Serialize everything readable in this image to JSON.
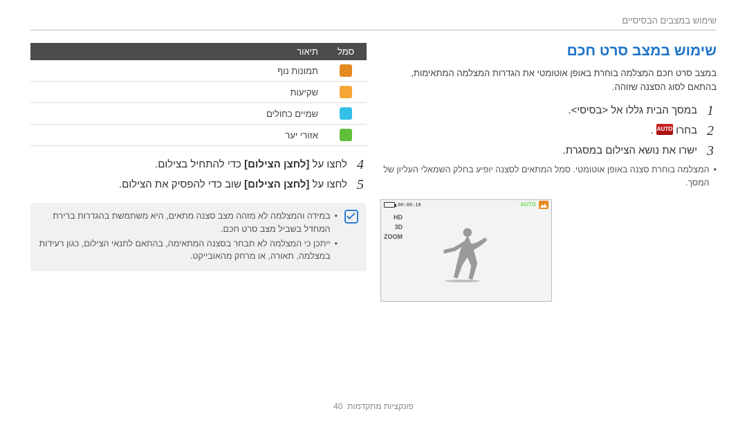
{
  "breadcrumb": "שימוש במצבים הבסיסיים",
  "section": {
    "title": "שימוש במצב סרט חכם",
    "description": "במצב סרט חכם המצלמה בוחרת באופן אוטומטי את הגדרות המצלמה המתאימות, בהתאם לסוג הסצנה שזוהה.",
    "steps_right": [
      {
        "num": "1",
        "text": "במסך הבית גללו אל <בסיסי>."
      },
      {
        "num": "2",
        "text_prefix": "בחרו",
        "auto_label": "AUTO",
        "text_suffix": "."
      },
      {
        "num": "3",
        "text": "ישרו את נושא הצילום במסגרת."
      }
    ],
    "sub_bullets_right": [
      "המצלמה בוחרת סצנה באופן אוטומטי. סמל המתאים לסצנה יופיע בחלק השמאלי העליון של המסך."
    ],
    "preview": {
      "scene_icon": "landscape",
      "label": "AUTO",
      "counter": "00:00:10",
      "side": [
        "HD",
        "3D",
        "ZOOM"
      ]
    }
  },
  "left": {
    "table": {
      "headers": {
        "symbol": "סמל",
        "desc": "תיאור"
      },
      "rows": [
        {
          "icon": "landscape",
          "desc": "תמונות נוף"
        },
        {
          "icon": "sunset",
          "desc": "שקיעות"
        },
        {
          "icon": "bluesky",
          "desc": "שמיים כחולים"
        },
        {
          "icon": "forest",
          "desc": "אזורי יער"
        }
      ]
    },
    "steps": [
      {
        "num": "4",
        "pre": "לחצו על ",
        "bold": "[לחצן הצילום]",
        "post": " כדי להתחיל בצילום."
      },
      {
        "num": "5",
        "pre": "לחצו על ",
        "bold": "[לחצן הצילום]",
        "post": " שוב כדי להפסיק את הצילום."
      }
    ],
    "info": [
      "במידה והמצלמה לא מזהה מצב סצנה מתאים, היא משתמשת בהגדרות ברירת המחדל בשביל מצב סרט חכם.",
      "ייתכן כי המצלמה לא תבחר בסצנה המתאימה, בהתאם לתנאי הצילום, כגון רעידות במצלמה, תאורה, או מרחק מהאובייקט."
    ]
  },
  "footer": {
    "label": "פונקציות מתקדמות",
    "page": "40"
  }
}
